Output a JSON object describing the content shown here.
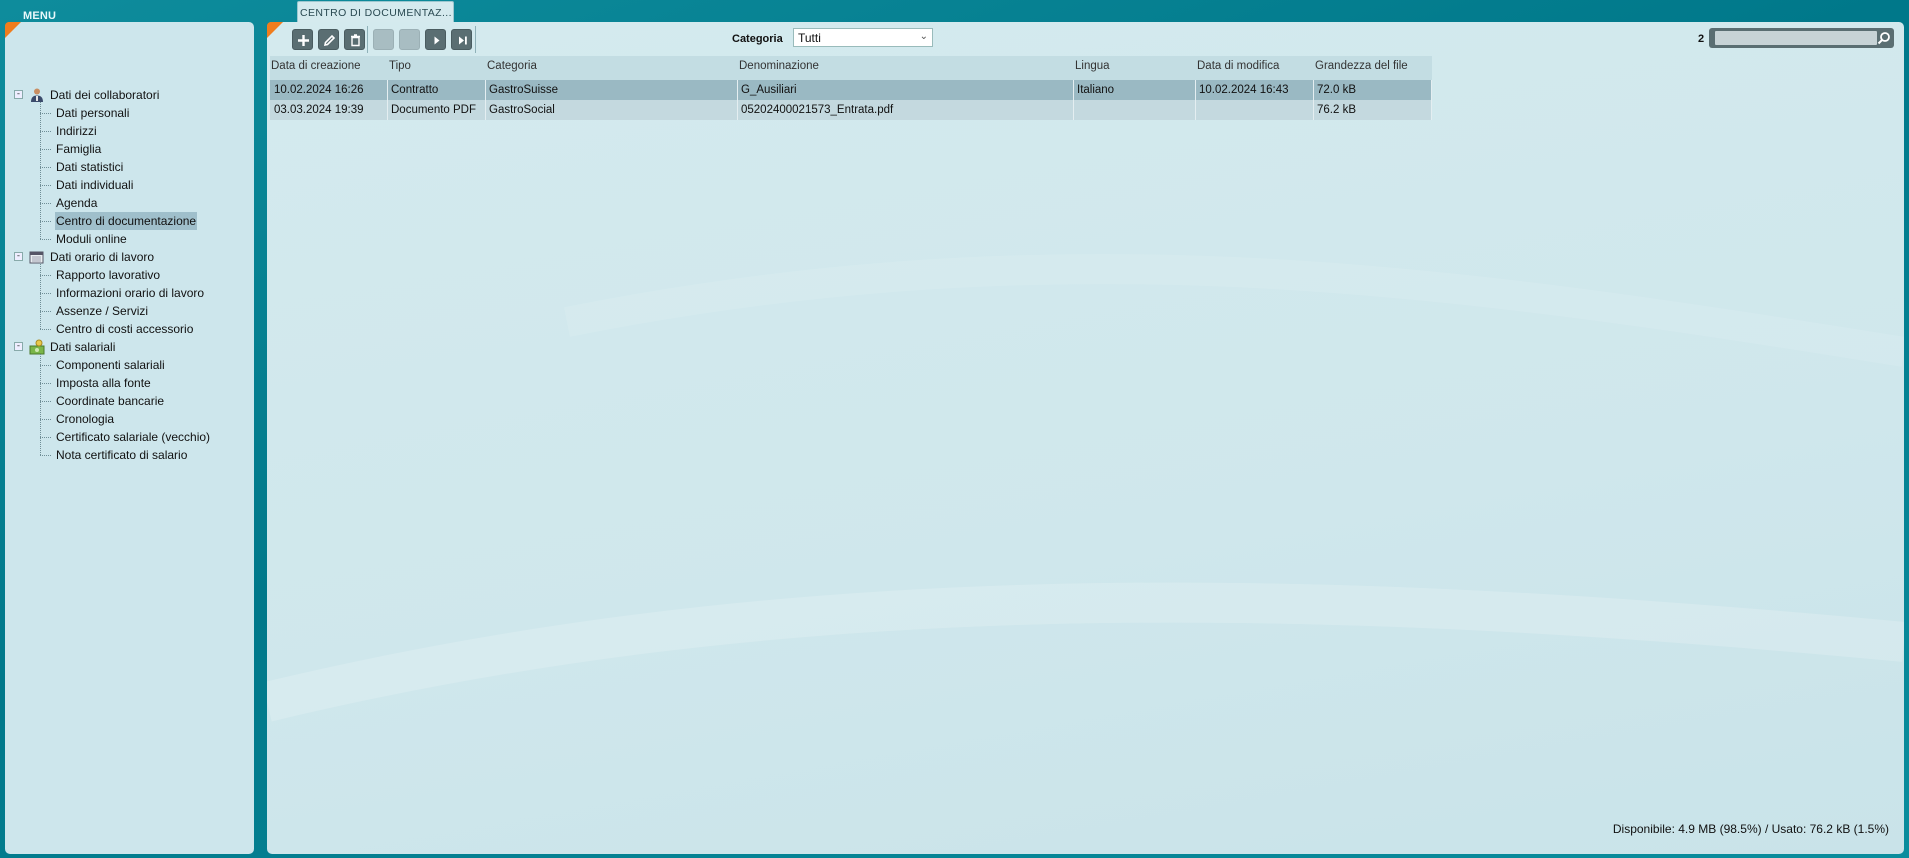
{
  "menu": {
    "title": "MENU"
  },
  "tab": {
    "label": "CENTRO DI DOCUMENTAZ..."
  },
  "tree": {
    "groups": [
      {
        "label": "Dati dei collaboratori",
        "icon": "person-icon",
        "children": [
          "Dati personali",
          "Indirizzi",
          "Famiglia",
          "Dati statistici",
          "Dati individuali",
          "Agenda",
          "Centro di documentazione",
          "Moduli online"
        ]
      },
      {
        "label": "Dati orario di lavoro",
        "icon": "calendar-icon",
        "children": [
          "Rapporto lavorativo",
          "Informazioni orario di lavoro",
          "Assenze / Servizi",
          "Centro di costi accessorio"
        ]
      },
      {
        "label": "Dati salariali",
        "icon": "money-icon",
        "children": [
          "Componenti salariali",
          "Imposta alla fonte",
          "Coordinate bancarie",
          "Cronologia",
          "Certificato salariale (vecchio)",
          "Nota certificato di salario"
        ]
      }
    ],
    "selected": "Centro di documentazione"
  },
  "toolbar": {
    "buttons": [
      {
        "name": "add-icon",
        "enabled": true
      },
      {
        "name": "edit-icon",
        "enabled": true
      },
      {
        "name": "delete-icon",
        "enabled": true
      },
      {
        "name": "first-page-icon",
        "enabled": false
      },
      {
        "name": "previous-page-icon",
        "enabled": false
      },
      {
        "name": "next-page-icon",
        "enabled": true
      },
      {
        "name": "last-page-icon",
        "enabled": true
      }
    ],
    "category_label": "Categoria",
    "category_value": "Tutti",
    "count": "2",
    "search_value": ""
  },
  "table": {
    "columns": [
      "Data di creazione",
      "Tipo",
      "Categoria",
      "Denominazione",
      "Lingua",
      "Data di modifica",
      "Grandezza del file"
    ],
    "rows": [
      [
        "10.02.2024 16:26",
        "Contratto",
        "GastroSuisse",
        "G_Ausiliari",
        "Italiano",
        "10.02.2024 16:43",
        "72.0 kB"
      ],
      [
        "03.03.2024 19:39",
        "Documento PDF",
        "GastroSocial",
        "05202400021573_Entrata.pdf",
        "",
        "",
        "76.2 kB"
      ]
    ]
  },
  "status": {
    "text": "Disponibile: 4.9 MB (98.5%) / Usato: 76.2 kB (1.5%)"
  },
  "colors": {
    "accent": "#f07d1d",
    "background": "#00788a",
    "panel": "#cde6ec",
    "selected_row": "#9ab9c3"
  }
}
